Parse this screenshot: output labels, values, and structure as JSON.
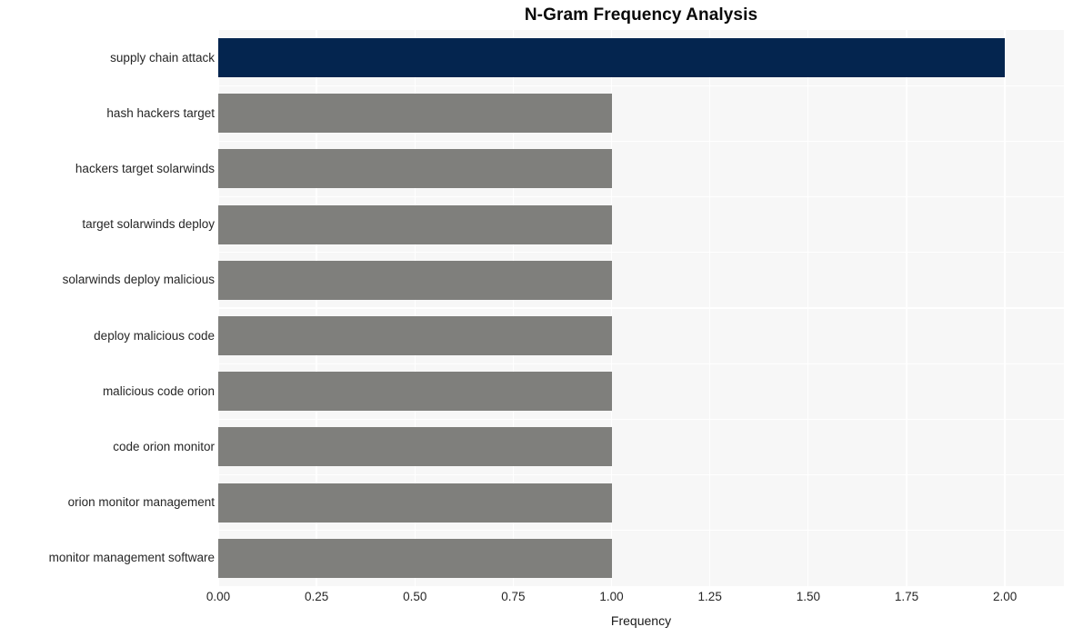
{
  "chart_data": {
    "type": "bar",
    "orientation": "horizontal",
    "title": "N-Gram Frequency Analysis",
    "xlabel": "Frequency",
    "ylabel": "",
    "categories": [
      "supply chain attack",
      "hash hackers target",
      "hackers target solarwinds",
      "target solarwinds deploy",
      "solarwinds deploy malicious",
      "deploy malicious code",
      "malicious code orion",
      "code orion monitor",
      "orion monitor management",
      "monitor management software"
    ],
    "values": [
      2,
      1,
      1,
      1,
      1,
      1,
      1,
      1,
      1,
      1
    ],
    "bar_colors": [
      "#04254f",
      "#7f7f7c",
      "#7f7f7c",
      "#7f7f7c",
      "#7f7f7c",
      "#7f7f7c",
      "#7f7f7c",
      "#7f7f7c",
      "#7f7f7c",
      "#7f7f7c"
    ],
    "xlim": [
      0,
      2.15
    ],
    "xticks": [
      0,
      0.25,
      0.5,
      0.75,
      1,
      1.25,
      1.5,
      1.75,
      2
    ],
    "xtick_labels": [
      "0.00",
      "0.25",
      "0.50",
      "0.75",
      "1.00",
      "1.25",
      "1.50",
      "1.75",
      "2.00"
    ],
    "grid": true,
    "grid_color": "#ffffff",
    "plot_background": "#f7f7f7",
    "figure_background": "#ffffff",
    "legend": null,
    "highlight_color": "#04254f",
    "default_color": "#7f7f7c"
  }
}
